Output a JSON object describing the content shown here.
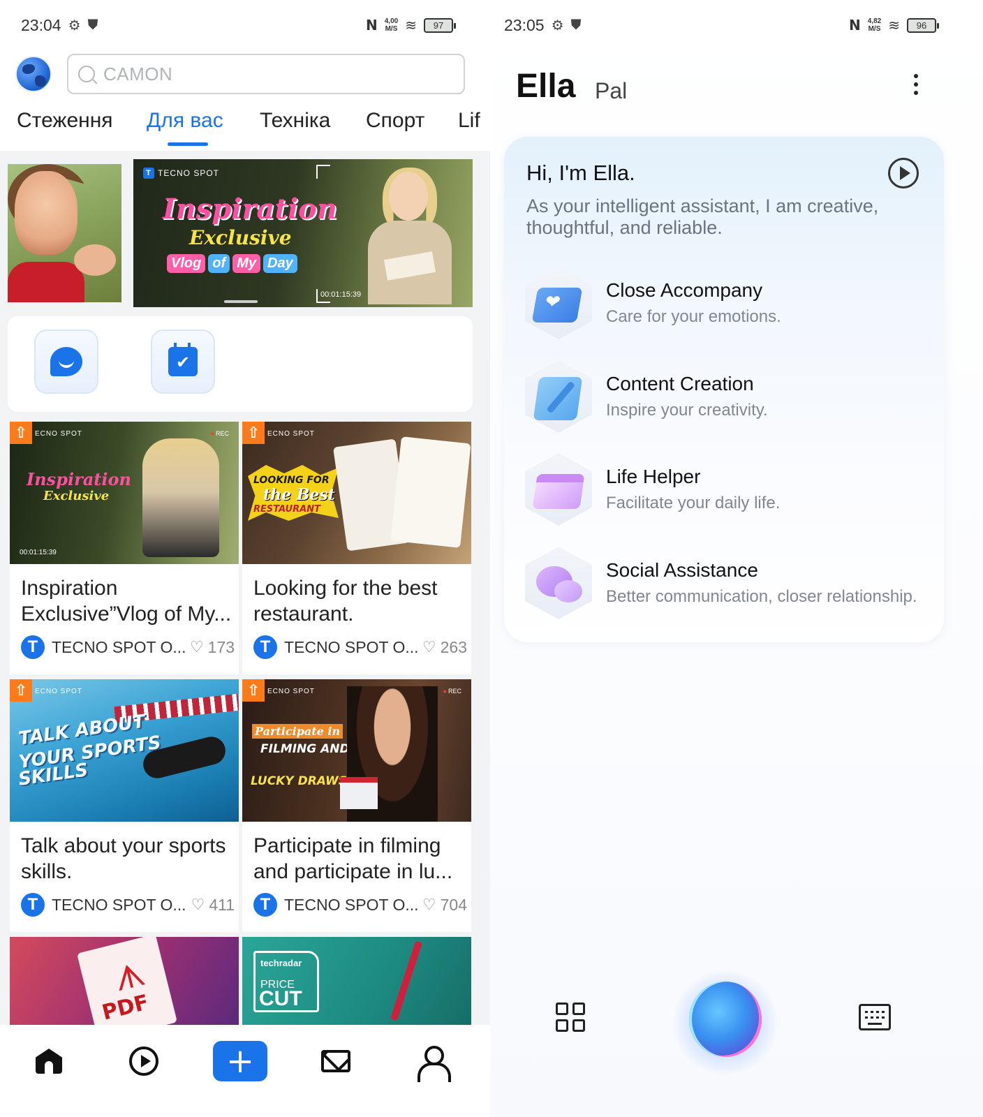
{
  "left": {
    "status": {
      "time": "23:04",
      "speed": "4,00\nM/S",
      "battery": "97"
    },
    "search": {
      "placeholder": "CAMON"
    },
    "tabs": [
      "Стеження",
      "Для вас",
      "Техніка",
      "Спорт",
      "Lif"
    ],
    "active_tab": "Для вас",
    "banner": {
      "brand": "TECNO SPOT",
      "title_line1": "Inspiration",
      "title_line2": "Exclusive",
      "vlog_words": [
        "Vlog",
        "of",
        "My",
        "Day"
      ],
      "timestamp": "00:01:15:39"
    },
    "shortcuts": [
      {
        "icon": "chat-bubble-icon"
      },
      {
        "icon": "calendar-check-icon"
      }
    ],
    "cards": [
      {
        "title": "Inspiration Exclusive”Vlog of My...",
        "author": "TECNO SPOT O...",
        "likes": "173",
        "thumb_text": "Inspiration",
        "thumb_text2": "Exclusive",
        "thumb_ts": "00:01:15:39"
      },
      {
        "title": "Looking for the best restaurant.",
        "author": "TECNO SPOT O...",
        "likes": "263",
        "thumb_text": "LOOKING FOR",
        "thumb_text2": "the Best",
        "thumb_text3": "RESTAURANT"
      },
      {
        "title": "Talk about your sports skills.",
        "author": "TECNO SPOT O...",
        "likes": "411",
        "thumb_text": "TALK ABOUT",
        "thumb_text2": "YOUR SPORTS",
        "thumb_text3": "SKILLS"
      },
      {
        "title": "Participate in filming and participate in lu...",
        "author": "TECNO SPOT O...",
        "likes": "704",
        "thumb_text": "Participate in",
        "thumb_text2": "FILMING AND",
        "thumb_text3": "LUCKY DRAWS"
      }
    ],
    "peek_cards": [
      {
        "thumb_text": "PDF"
      },
      {
        "thumb_text": "techradar",
        "thumb_text2": "PRICE",
        "thumb_text3": "CUT"
      }
    ],
    "thumb_brand": "ECNO SPOT",
    "rec": "REC",
    "avatar_letter": "T"
  },
  "right": {
    "status": {
      "time": "23:05",
      "speed": "4,82\nM/S",
      "battery": "96"
    },
    "title": "Ella",
    "subtitle": "Pal",
    "greeting": "Hi, I'm Ella.",
    "intro": "As your intelligent assistant, I am creative, thoughtful, and reliable.",
    "features": [
      {
        "name": "Close Accompany",
        "desc": "Care for your emotions."
      },
      {
        "name": "Content Creation",
        "desc": "Inspire your creativity."
      },
      {
        "name": "Life Helper",
        "desc": "Facilitate your daily life."
      },
      {
        "name": "Social Assistance",
        "desc": "Better communication, closer relationship."
      }
    ]
  },
  "colors": {
    "accent": "#1a73e8",
    "orange_badge": "#ff7b1a"
  }
}
